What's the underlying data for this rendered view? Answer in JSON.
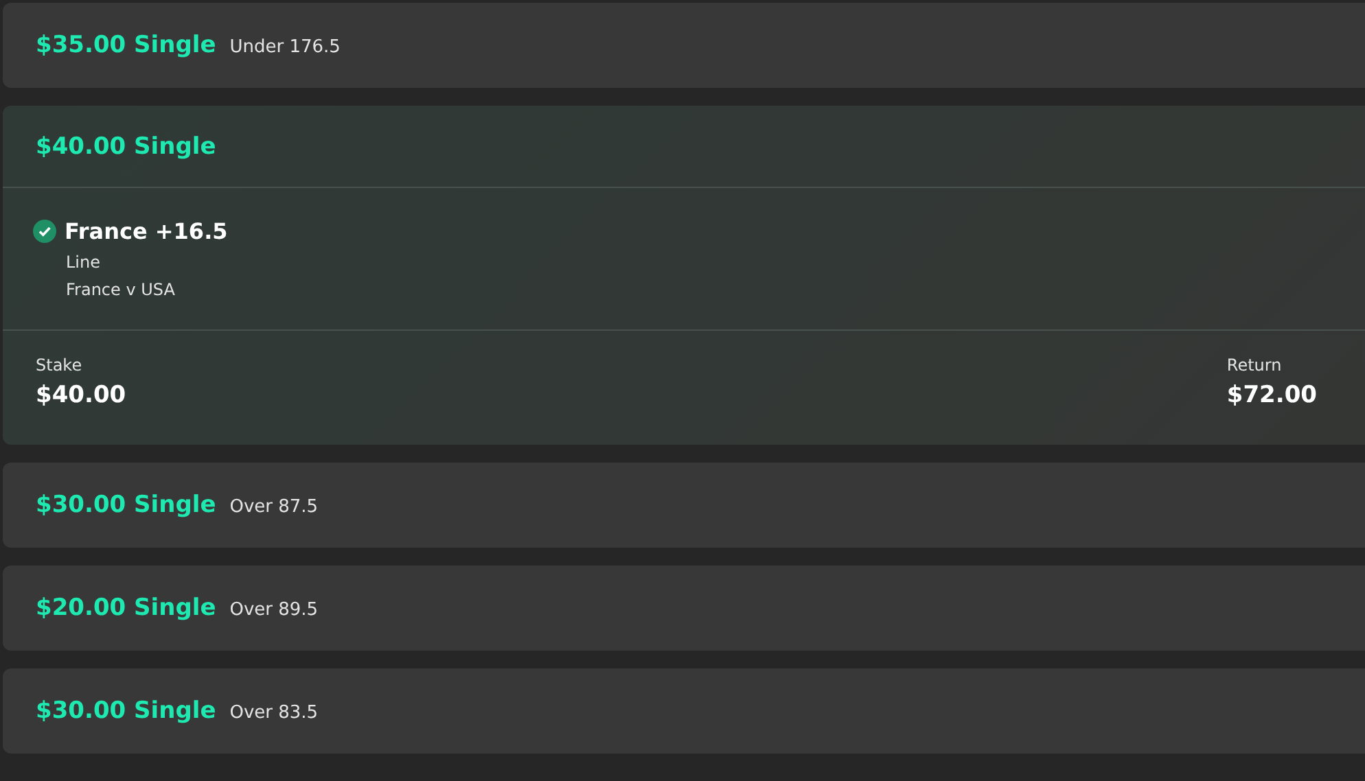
{
  "bets": [
    {
      "title": "$35.00 Single",
      "subtitle": "Under 176.5",
      "expanded": false
    },
    {
      "title": "$40.00 Single",
      "expanded": true,
      "leg": {
        "name": "France +16.5",
        "checked": true,
        "market": "Line",
        "event": "France v USA"
      },
      "stake_label": "Stake",
      "stake": "$40.00",
      "return_label": "Return",
      "return": "$72.00"
    },
    {
      "title": "$30.00 Single",
      "subtitle": "Over 87.5",
      "expanded": false
    },
    {
      "title": "$20.00 Single",
      "subtitle": "Over 89.5",
      "expanded": false
    },
    {
      "title": "$30.00 Single",
      "subtitle": "Over 83.5",
      "expanded": false
    }
  ]
}
